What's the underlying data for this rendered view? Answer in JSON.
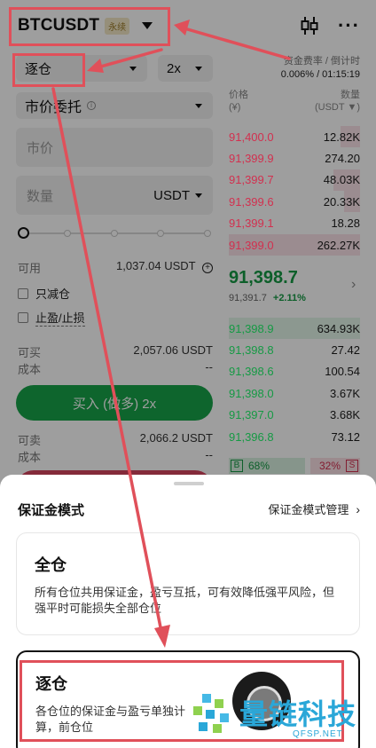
{
  "header": {
    "pair": "BTCUSDT",
    "perp_badge": "永续",
    "funding_label": "资金费率 / 倒计时",
    "funding_value": "0.006% / 01:15:19"
  },
  "controls": {
    "margin_mode": "逐仓",
    "leverage": "2x",
    "order_type": "市价委托",
    "price_placeholder": "市价",
    "qty_placeholder": "数量",
    "qty_unit": "USDT"
  },
  "account": {
    "available_label": "可用",
    "available_value": "1,037.04 USDT",
    "reduce_only": "只减仓",
    "tp_sl": "止盈/止损",
    "can_buy_label": "可买",
    "can_buy_value": "2,057.06 USDT",
    "cost_label": "成本",
    "cost_value": "--",
    "buy_button": "买入 (做多) 2x",
    "can_sell_label": "可卖",
    "can_sell_value": "2,066.2 USDT",
    "cost2_label": "成本",
    "cost2_value": "--"
  },
  "orderbook": {
    "price_header": "价格",
    "price_unit": "(¥)",
    "qty_header": "数量",
    "qty_unit": "(USDT ▼)",
    "asks": [
      {
        "price": "91,400.0",
        "qty": "12.82K",
        "depth": 0.15
      },
      {
        "price": "91,399.9",
        "qty": "274.20",
        "depth": 0.0
      },
      {
        "price": "91,399.7",
        "qty": "48.03K",
        "depth": 0.2
      },
      {
        "price": "91,399.6",
        "qty": "20.33K",
        "depth": 0.12
      },
      {
        "price": "91,399.1",
        "qty": "18.28",
        "depth": 0.0
      },
      {
        "price": "91,399.0",
        "qty": "262.27K",
        "depth": 1.0
      }
    ],
    "last_price": "91,398.7",
    "mark_price": "91,391.7",
    "change": "+2.11%",
    "bids": [
      {
        "price": "91,398.9",
        "qty": "634.93K",
        "depth": 1.0
      },
      {
        "price": "91,398.8",
        "qty": "27.42",
        "depth": 0.0
      },
      {
        "price": "91,398.6",
        "qty": "100.54",
        "depth": 0.0
      },
      {
        "price": "91,398.0",
        "qty": "3.67K",
        "depth": 0.0
      },
      {
        "price": "91,397.0",
        "qty": "3.68K",
        "depth": 0.0
      },
      {
        "price": "91,396.8",
        "qty": "73.12",
        "depth": 0.0
      }
    ],
    "buy_tag": "B",
    "buy_ratio": "68%",
    "sell_ratio": "32%",
    "sell_tag": "S"
  },
  "sheet": {
    "title": "保证金模式",
    "manage": "保证金模式管理",
    "cross_title": "全仓",
    "cross_desc": "所有仓位共用保证金，盈亏互抵，可有效降低强平风险，但强平时可能损失全部仓位",
    "iso_title": "逐仓",
    "iso_desc": "各仓位的保证金与盈亏单独计算，前仓位"
  },
  "watermark": {
    "text": "量链科技",
    "sub": "QFSP.NET"
  },
  "colors": {
    "buy_green": "#18a34a",
    "sell_red": "#d2304f",
    "annotation_red": "#e0505a",
    "watermark_blue": "#2aa7d8"
  }
}
